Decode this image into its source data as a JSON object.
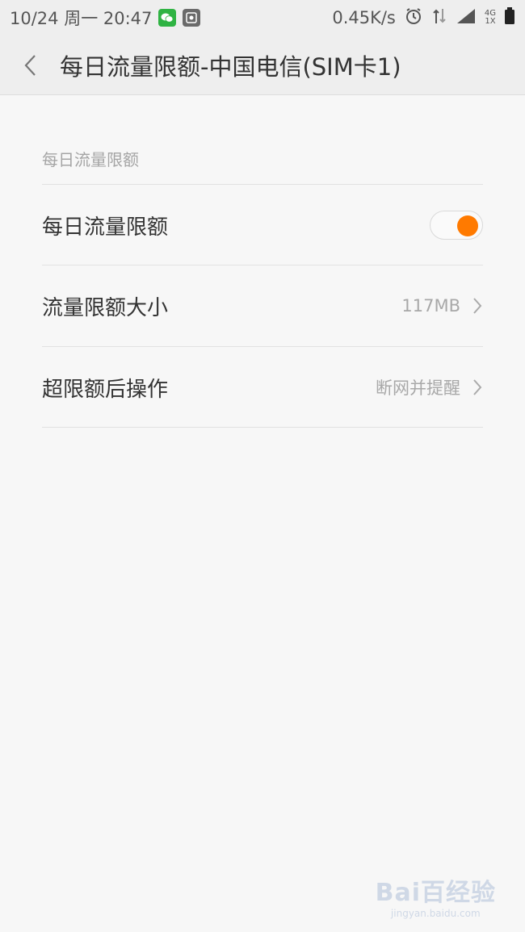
{
  "status_bar": {
    "time": "10/24 周一 20:47",
    "speed": "0.45K/s",
    "net_top": "4G",
    "net_bottom": "1X"
  },
  "header": {
    "title": "每日流量限额-中国电信(SIM卡1)"
  },
  "section": {
    "header": "每日流量限额",
    "rows": [
      {
        "label": "每日流量限额",
        "toggle_on": true
      },
      {
        "label": "流量限额大小",
        "value": "117MB"
      },
      {
        "label": "超限额后操作",
        "value": "断网并提醒"
      }
    ]
  },
  "colors": {
    "accent": "#ff7a00",
    "background": "#f7f7f7",
    "header_bg": "#eeeeee"
  },
  "watermark": {
    "main": "Bai百经验",
    "sub": "jingyan.baidu.com"
  }
}
